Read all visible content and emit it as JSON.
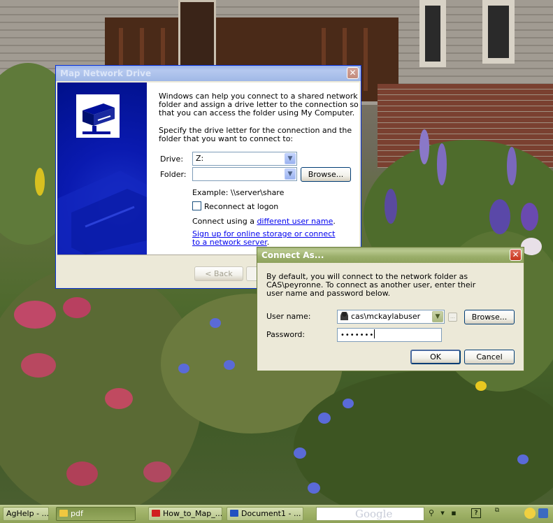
{
  "map_network_drive": {
    "title": "Map Network Drive",
    "intro": "Windows can help you connect to a shared network folder and assign a drive letter to the connection so that you can access the folder using My Computer.",
    "instruction": "Specify the drive letter for the connection and the folder that you want to connect to:",
    "drive_label": "Drive:",
    "drive_value": "Z:",
    "folder_label": "Folder:",
    "folder_value": "",
    "browse_label": "Browse...",
    "example": "Example: \\\\server\\share",
    "reconnect_label": "Reconnect at logon",
    "reconnect_checked": false,
    "connect_using_prefix": "Connect using a ",
    "connect_using_link": "different user name",
    "connect_using_suffix": ".",
    "signup_link": "Sign up for online storage or connect to a network server",
    "signup_suffix": ".",
    "back_label": "< Back"
  },
  "connect_as": {
    "title": "Connect As...",
    "description": "By default, you will connect to the network folder as CAS\\peyronne. To connect as another user, enter their user name and password below.",
    "username_label": "User name:",
    "username_value": "cas\\mckaylabuser",
    "password_label": "Password:",
    "password_value": "•••••••",
    "browse_label": "Browse...",
    "ok_label": "OK",
    "cancel_label": "Cancel"
  },
  "taskbar": {
    "items": [
      {
        "label": "AgHelp - ..."
      },
      {
        "label": "pdf"
      },
      {
        "label": "How_to_Map_..."
      },
      {
        "label": "Document1 - ..."
      }
    ],
    "search_brand": "Google"
  },
  "colors": {
    "xp_blue": "#0a58e0",
    "olive_title": "#9aae6a",
    "wizard_panel": "#00109a"
  }
}
